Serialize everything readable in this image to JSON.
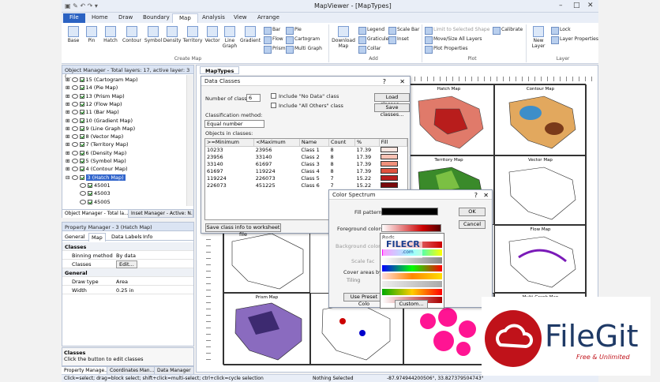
{
  "window": {
    "title": "MapViewer - [MapTypes]",
    "controls": [
      "–",
      "□",
      "✕"
    ]
  },
  "ribbon": {
    "tabs": [
      "File",
      "Home",
      "Draw",
      "Boundary",
      "Map",
      "Analysis",
      "View",
      "Arrange"
    ],
    "active_tab": "Map",
    "create_map": {
      "buttons": [
        "Base",
        "Pin",
        "Hatch",
        "Contour",
        "Symbol",
        "Density",
        "Territory",
        "Vector",
        "Line Graph",
        "Gradient"
      ],
      "small": [
        "Bar",
        "Pie",
        "Flow",
        "Cartogram",
        "Prism",
        "Multi Graph"
      ],
      "label": "Create Map"
    },
    "add": {
      "download_label": "Download Map",
      "small": [
        "Legend",
        "Scale Bar",
        "Graticule",
        "Inset",
        "Collar"
      ],
      "label": "Add"
    },
    "plot": {
      "small": [
        "Limit to Selected Shape",
        "Calibrate",
        "Move/Size All Layers",
        "Plot Properties"
      ],
      "label": "Plot"
    },
    "layer": {
      "new_layer": "New Layer",
      "small": [
        "Lock",
        "Layer Properties"
      ],
      "label": "Layer"
    }
  },
  "object_manager": {
    "title": "Object Manager - Total layers: 17, active layer: 3 (...",
    "items": [
      "15 (Cartogram Map)",
      "14 (Pie Map)",
      "13 (Prism Map)",
      "12 (Flow Map)",
      "11 (Bar Map)",
      "10 (Gradient Map)",
      "9 (Line Graph Map)",
      "8 (Vector Map)",
      "7 (Territory Map)",
      "6 (Density Map)",
      "5 (Symbol Map)",
      "4 (Contour Map)",
      "3 (Hatch Map)",
      "45001",
      "45003",
      "45005"
    ],
    "selected": "3 (Hatch Map)",
    "tabs": [
      "Object Manager - Total la...",
      "Inset Manager - Active: N..."
    ]
  },
  "property_manager": {
    "title": "Property Manager - 3 (Hatch Map)",
    "tabs": [
      "General",
      "Map",
      "Data Labels",
      "Info"
    ],
    "active_tab": "Map",
    "sections": [
      {
        "name": "Classes",
        "rows": [
          {
            "k": "Binning method",
            "v": "By data"
          },
          {
            "k": "Classes",
            "v": "Edit..."
          }
        ]
      },
      {
        "name": "General",
        "rows": [
          {
            "k": "Draw type",
            "v": "Area"
          },
          {
            "k": "Width",
            "v": "0.25 in"
          }
        ]
      }
    ],
    "help_title": "Classes",
    "help_text": "Click the button to edit classes",
    "bottom_tabs": [
      "Property Manage...",
      "Coordinates Man...",
      "Data Manager"
    ]
  },
  "map_doc": {
    "tab": "MapTypes",
    "cells": [
      "Hatch Map",
      "Contour Map",
      "Territory Map",
      "Vector Map",
      "",
      "Flow Map",
      "Prism Map",
      "",
      "Multi-Graph Map"
    ]
  },
  "data_classes": {
    "title": "Data Classes",
    "num_classes_label": "Number of classes:",
    "num_classes": "6",
    "include_nodata": "Include \"No Data\" class",
    "include_allothers": "Include \"All Others\" class",
    "load_btn": "Load classes...",
    "save_btn": "Save classes...",
    "method_label": "Classification method:",
    "method_value": "Equal number",
    "objects_label": "Objects in classes:",
    "columns": [
      ">=Minimum",
      "<Maximum",
      "Name",
      "Count",
      "%",
      "Fill"
    ],
    "rows": [
      {
        "min": "10233",
        "max": "23956",
        "name": "Class 1",
        "count": "8",
        "pct": "17.39",
        "fill": "#fde6e0"
      },
      {
        "min": "23956",
        "max": "33140",
        "name": "Class 2",
        "count": "8",
        "pct": "17.39",
        "fill": "#f9c2b4"
      },
      {
        "min": "33140",
        "max": "61697",
        "name": "Class 3",
        "count": "8",
        "pct": "17.39",
        "fill": "#f0917c"
      },
      {
        "min": "61697",
        "max": "119224",
        "name": "Class 4",
        "count": "8",
        "pct": "17.39",
        "fill": "#e0523e"
      },
      {
        "min": "119224",
        "max": "226073",
        "name": "Class 5",
        "count": "7",
        "pct": "15.22",
        "fill": "#b81d1c"
      },
      {
        "min": "226073",
        "max": "451225",
        "name": "Class 6",
        "count": "7",
        "pct": "15.22",
        "fill": "#7a0a0c"
      }
    ],
    "save_ws_btn": "Save class info to worksheet file"
  },
  "color_spectrum": {
    "title": "Color Spectrum",
    "fill_pattern_label": "Fill pattern:",
    "fg_label": "Foreground colors:",
    "bg_label": "Background colors:",
    "scale_label": "Scale fac",
    "cover_label": "Cover areas by",
    "tiling_label": "Tiling",
    "preset_btn": "Use Preset Colo",
    "ok": "OK",
    "cancel": "Cancel",
    "dropdown_title": "Reds",
    "custom": "Custom..."
  },
  "status": {
    "hint": "Click=select; drag=block select; shift+click=multi-select; ctrl+click=cycle selection",
    "selection": "Nothing Selected",
    "coords": "-87.974944200506°, 33.827379504743°"
  },
  "watermark": {
    "brand": "FileGit",
    "tagline": "Free & Unlimited",
    "overlay": "FILECR",
    "overlay_sub": ".com"
  }
}
